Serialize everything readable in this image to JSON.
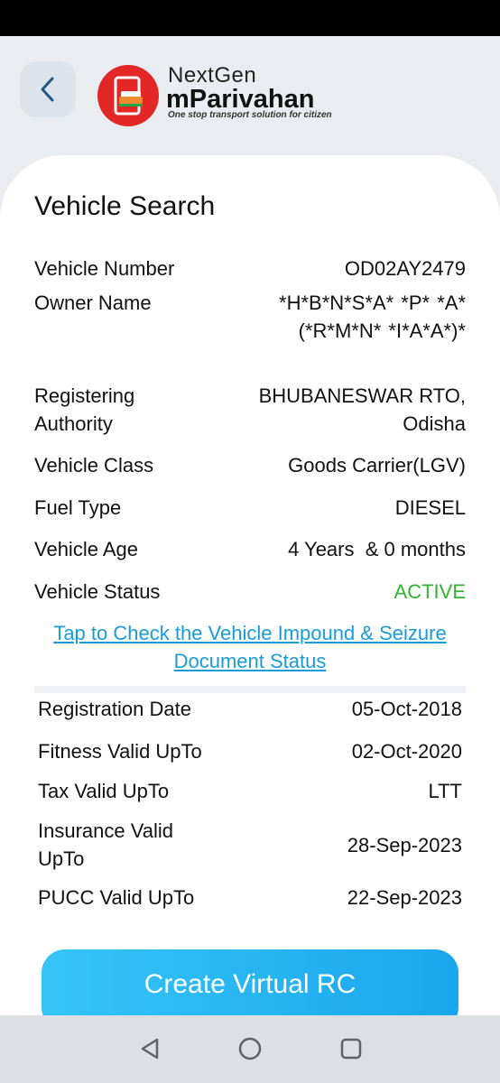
{
  "header": {
    "brand_top": "NextGen",
    "brand_main": "mParivahan",
    "tagline": "One stop transport solution for citizen",
    "accent_color": "#e32626"
  },
  "card": {
    "title": "Vehicle Search",
    "rows": [
      {
        "label": "Vehicle Number",
        "value": "OD02AY2479"
      },
      {
        "label": "Owner Name",
        "value": "*H*B*N*S*A* *P*  *A*(*R*M*N* *I*A*A*)*"
      },
      {
        "label": "Registering Authority",
        "value": "BHUBANESWAR RTO, Odisha"
      },
      {
        "label": "Vehicle Class",
        "value": "Goods Carrier(LGV)"
      },
      {
        "label": "Fuel Type",
        "value": "DIESEL"
      },
      {
        "label": "Vehicle Age",
        "value": "4 Years  & 0 months"
      },
      {
        "label": "Vehicle Status",
        "value": "ACTIVE"
      }
    ],
    "status_color": "#2fb52f",
    "impound_link": "Tap to Check the Vehicle Impound & Seizure Document Status",
    "link_color": "#1a9cd8",
    "validity": [
      {
        "label": "Registration Date",
        "value": "05-Oct-2018"
      },
      {
        "label": "Fitness Valid UpTo",
        "value": "02-Oct-2020"
      },
      {
        "label": "Tax Valid UpTo",
        "value": "LTT"
      },
      {
        "label": "Insurance Valid UpTo",
        "value": "28-Sep-2023"
      },
      {
        "label": "PUCC Valid UpTo",
        "value": "22-Sep-2023"
      }
    ],
    "cta_label": "Create Virtual RC"
  },
  "nav": {
    "icons": [
      "back-triangle-icon",
      "home-circle-icon",
      "recents-square-icon"
    ]
  }
}
